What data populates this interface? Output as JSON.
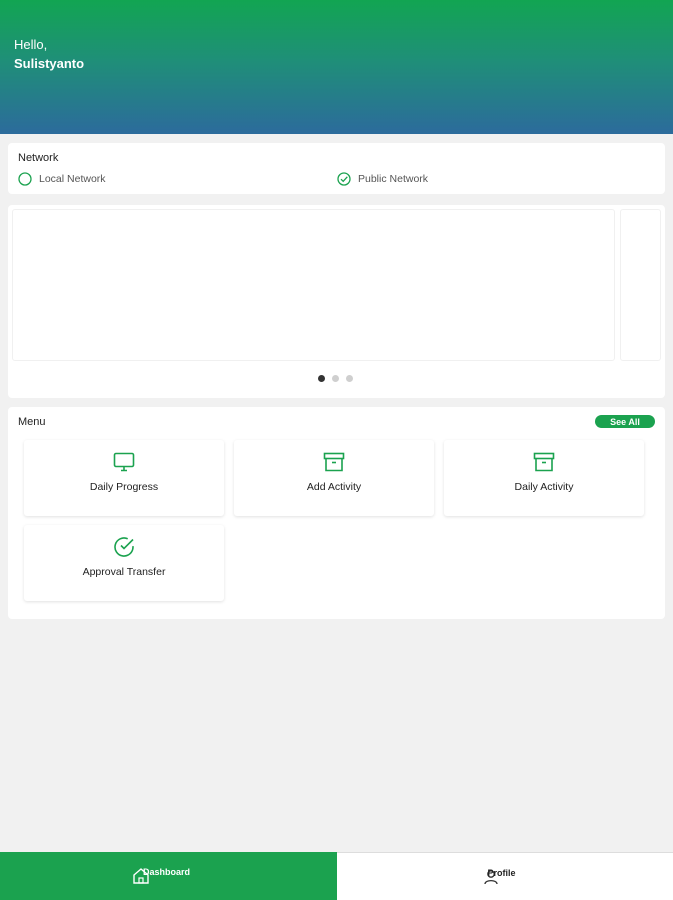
{
  "header": {
    "greeting": "Hello,",
    "username": "Sulistyanto"
  },
  "network": {
    "title": "Network",
    "options": [
      {
        "label": "Local Network",
        "selected": false,
        "icon": "radio-empty-icon"
      },
      {
        "label": "Public Network",
        "selected": true,
        "icon": "check-circle-icon"
      }
    ]
  },
  "carousel": {
    "slides": 3,
    "active_index": 0
  },
  "menu": {
    "title": "Menu",
    "see_all": "See All",
    "items": [
      {
        "label": "Daily Progress",
        "icon": "monitor-icon"
      },
      {
        "label": "Add Activity",
        "icon": "archive-box-icon"
      },
      {
        "label": "Daily Activity",
        "icon": "archive-box-icon"
      },
      {
        "label": "Approval Transfer",
        "icon": "check-circle-icon"
      }
    ]
  },
  "bottom_nav": {
    "items": [
      {
        "label": "Dashboard",
        "icon": "home-icon",
        "active": true
      },
      {
        "label": "Profile",
        "icon": "user-icon",
        "active": false
      }
    ]
  },
  "colors": {
    "accent": "#1ba24f",
    "header_top": "#12a552",
    "header_bottom": "#2c6b9c"
  }
}
